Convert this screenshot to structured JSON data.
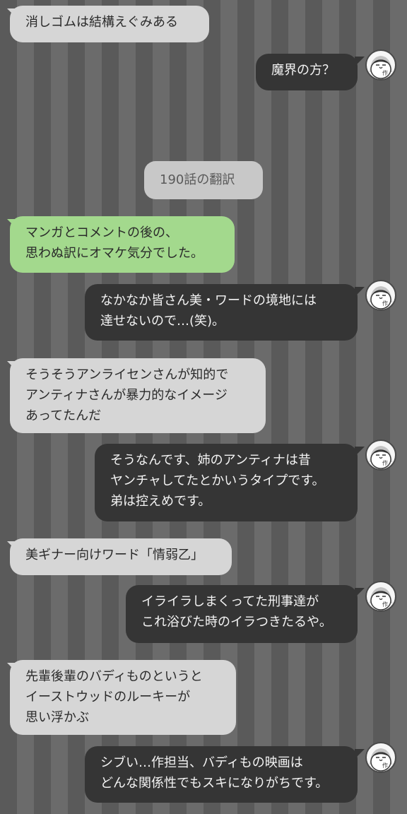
{
  "messages": [
    {
      "side": "left",
      "text": "消しゴムは結構えぐみある"
    },
    {
      "side": "right",
      "text": "魔界の方？"
    },
    {
      "side": "center",
      "text": "190話の翻訳"
    },
    {
      "side": "left",
      "style": "green",
      "text": "マンガとコメントの後の、\n思わぬ訳にオマケ気分でした。"
    },
    {
      "side": "right",
      "text": "なかなか皆さん美・ワードの境地には\n達せないので…(笑)。"
    },
    {
      "side": "left",
      "text": "そうそうアンライセンさんが知的で\nアンティナさんが暴力的なイメージ\nあってたんだ"
    },
    {
      "side": "right",
      "text": "そうなんです、姉のアンティナは昔\nヤンチャしてたとかいうタイプです。\n弟は控えめです。"
    },
    {
      "side": "left",
      "text": "美ギナー向けワード「情弱乙」"
    },
    {
      "side": "right",
      "text": "イライラしまくってた刑事達が\nこれ浴びた時のイラつきたるや。"
    },
    {
      "side": "left",
      "text": "先輩後輩のバディものというと\nイーストウッドのルーキーが\n思い浮かぶ"
    },
    {
      "side": "right",
      "text": "シブい…作担当、バディもの映画は\nどんな関係性でもスキになりがちです。"
    }
  ],
  "avatar": {
    "label": "作",
    "icon": "author-face-icon"
  },
  "colors": {
    "left_bubble": "#d6d6d6",
    "green_bubble": "#a3d98d",
    "right_bubble": "#353535",
    "center_bubble": "#c8c8c8",
    "stripe_dark": "#5a5a5a",
    "stripe_light": "#6b6b6b"
  }
}
